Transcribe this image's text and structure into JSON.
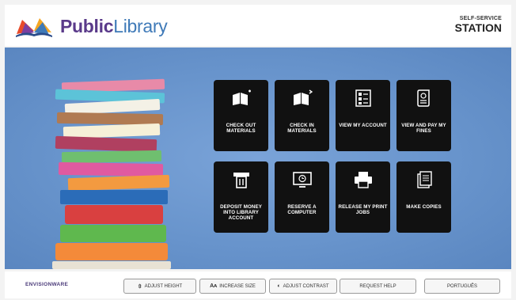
{
  "header": {
    "brand_part1": "Public",
    "brand_part2": "Library",
    "station_small": "SELF-SERVICE",
    "station_big": "STATION"
  },
  "tiles": [
    {
      "label": "CHECK OUT MATERIALS",
      "icon": "book-checkout-icon"
    },
    {
      "label": "CHECK IN MATERIALS",
      "icon": "book-checkin-icon"
    },
    {
      "label": "VIEW MY ACCOUNT",
      "icon": "account-list-icon"
    },
    {
      "label": "VIEW AND PAY MY FINES",
      "icon": "receipt-icon"
    },
    {
      "label": "DEPOSIT MONEY INTO LIBRARY ACCOUNT",
      "icon": "atm-icon"
    },
    {
      "label": "RESERVE A COMPUTER",
      "icon": "monitor-clock-icon"
    },
    {
      "label": "RELEASE MY PRINT JOBS",
      "icon": "printer-icon"
    },
    {
      "label": "MAKE COPIES",
      "icon": "copier-icon"
    }
  ],
  "footer": {
    "vendor": "ENVISIONWARE",
    "buttons": [
      {
        "glyph": "⇳",
        "label": "ADJUST HEIGHT"
      },
      {
        "glyph": "Aᴀ",
        "label": "INCREASE SIZE"
      },
      {
        "glyph": "◐",
        "label": "ADJUST CONTRAST"
      },
      {
        "glyph": "",
        "label": "REQUEST HELP"
      },
      {
        "glyph": "",
        "label": "PORTUGUÊS"
      }
    ]
  },
  "colors": {
    "brand_purple": "#5a3a8a",
    "brand_blue": "#3f7ab8",
    "background_blue": "#6894cc",
    "tile": "#111111"
  }
}
